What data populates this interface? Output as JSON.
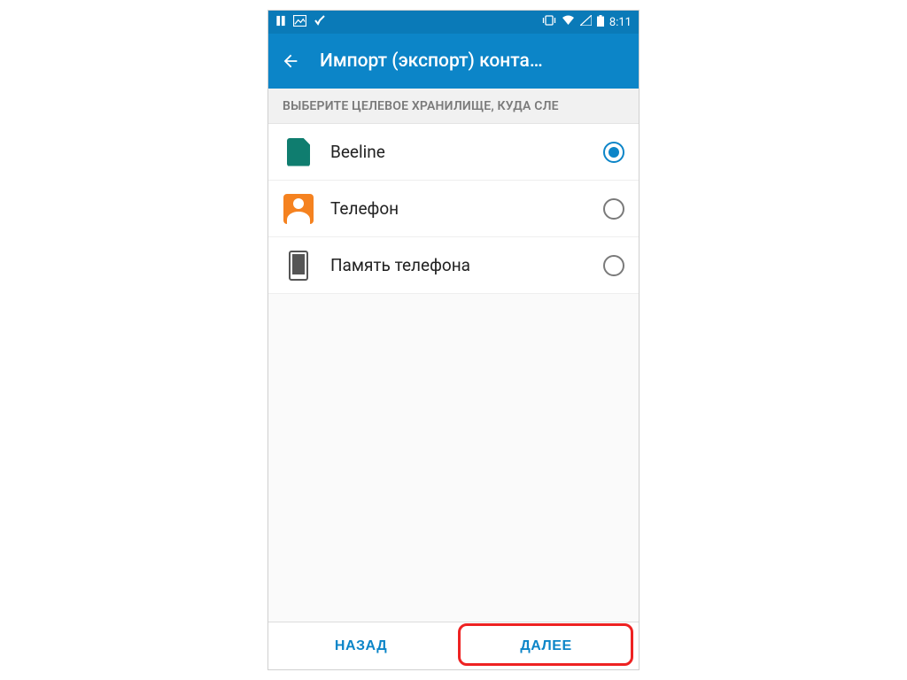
{
  "status": {
    "time": "8:11"
  },
  "header": {
    "title": "Импорт (экспорт) конта…"
  },
  "section": {
    "header": "ВЫБЕРИТЕ ЦЕЛЕВОЕ ХРАНИЛИЩЕ, КУДА СЛЕ"
  },
  "options": [
    {
      "label": "Beeline",
      "icon": "sim-icon",
      "selected": true
    },
    {
      "label": "Телефон",
      "icon": "contact-icon",
      "selected": false
    },
    {
      "label": "Память телефона",
      "icon": "phone-storage-icon",
      "selected": false
    }
  ],
  "buttons": {
    "back": "НАЗАД",
    "next": "ДАЛЕЕ"
  },
  "colors": {
    "primary": "#0c85c8",
    "status": "#0a7ab8",
    "sim": "#0f7d6f",
    "contact": "#f58220"
  }
}
